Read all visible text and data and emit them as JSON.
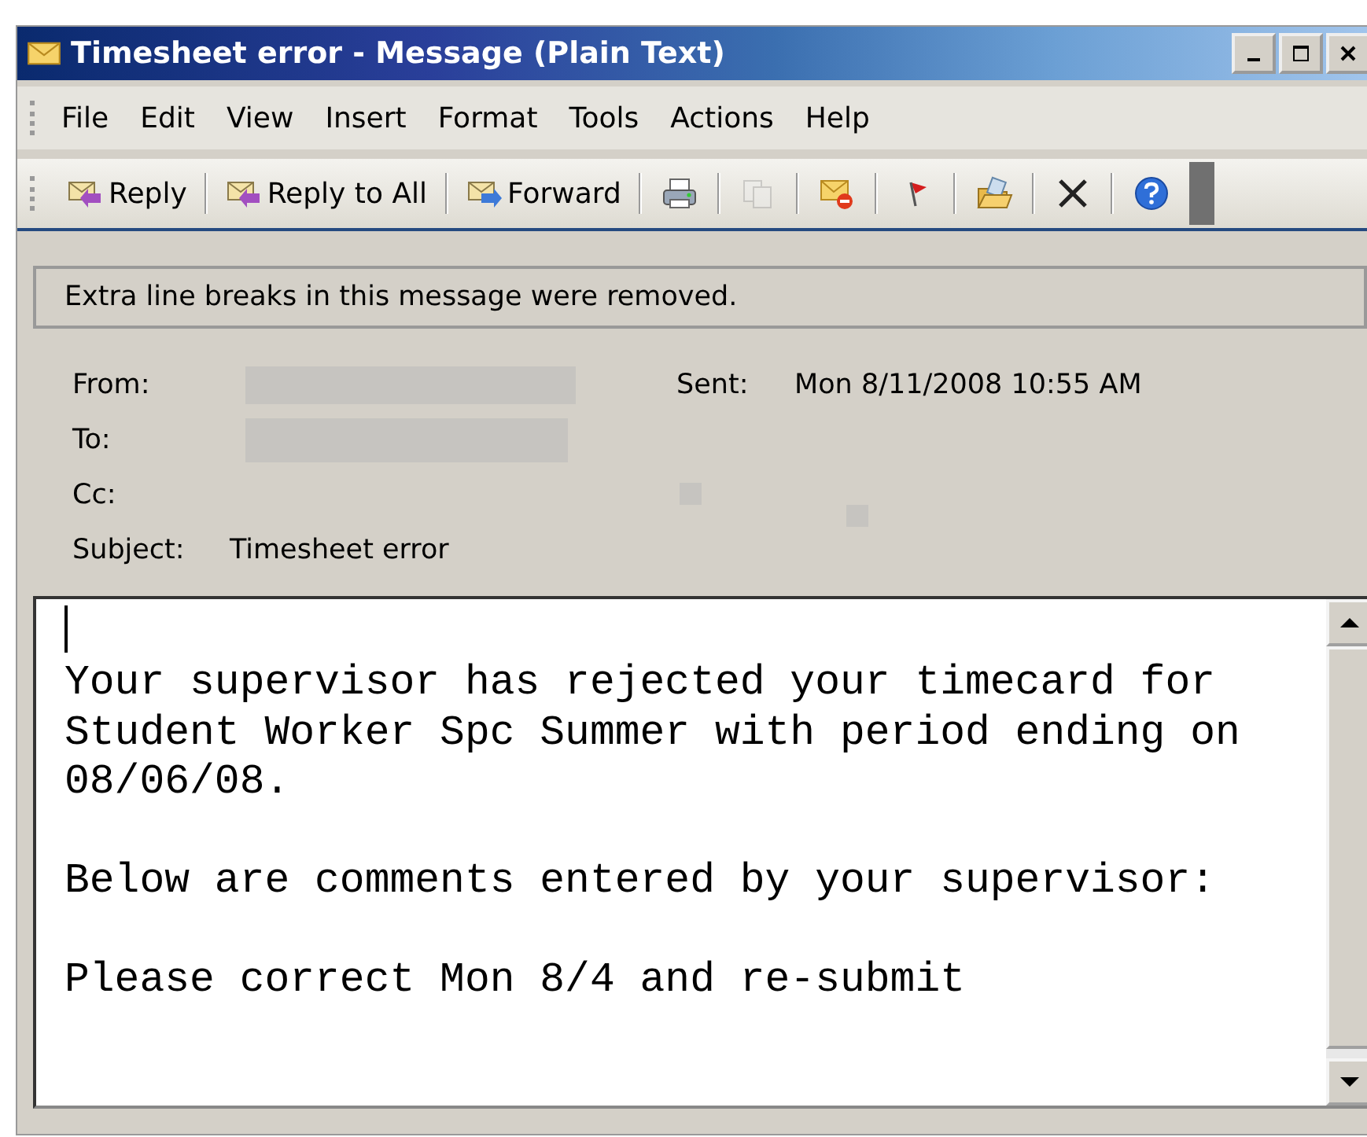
{
  "window": {
    "title": "Timesheet error - Message (Plain Text)"
  },
  "menu": [
    "File",
    "Edit",
    "View",
    "Insert",
    "Format",
    "Tools",
    "Actions",
    "Help"
  ],
  "toolbar": {
    "text_buttons": [
      {
        "label": "Reply"
      },
      {
        "label": "Reply to All"
      },
      {
        "label": "Forward"
      }
    ],
    "icon_buttons": [
      {
        "disabled": false
      },
      {
        "disabled": true
      },
      {
        "disabled": false
      },
      {
        "disabled": false
      },
      {
        "disabled": false
      },
      {
        "disabled": false
      },
      {
        "disabled": false
      }
    ]
  },
  "notice": "Extra line breaks in this message were removed.",
  "header": {
    "from_label": "From:",
    "sent_label": "Sent:",
    "sent": "Mon 8/11/2008 10:55 AM",
    "to_label": "To:",
    "cc_label": "Cc:",
    "subject_label": "Subject:",
    "subject": "Timesheet error"
  },
  "body": {
    "paragraphs": [
      {
        "lines": [
          "Your supervisor has rejected your timecard for",
          "Student Worker Spc Summer with period ending on",
          "08/06/08."
        ]
      },
      {
        "lines": [
          "Below are comments entered by your supervisor:"
        ]
      },
      {
        "lines": [
          "Please correct Mon 8/4 and re-submit"
        ]
      }
    ]
  }
}
